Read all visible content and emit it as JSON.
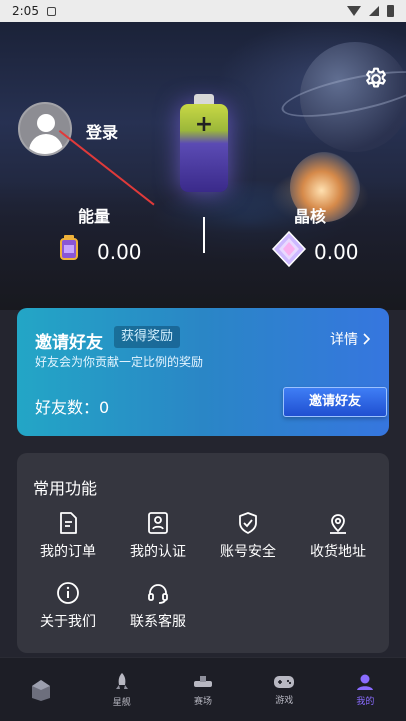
{
  "status_bar": {
    "time": "2:05"
  },
  "profile": {
    "login_label": "登录"
  },
  "stats": {
    "energy": {
      "label": "能量",
      "value": "0.00"
    },
    "crystal": {
      "label": "晶核",
      "value": "0.00"
    }
  },
  "invite": {
    "title": "邀请好友",
    "reward_tag": "获得奖励",
    "details_label": "详情",
    "subtitle": "好友会为你贡献一定比例的奖励",
    "friend_count_label": "好友数：0",
    "button_label": "邀请好友"
  },
  "functions": {
    "title": "常用功能",
    "items": [
      {
        "label": "我的订单",
        "icon": "order-icon"
      },
      {
        "label": "我的认证",
        "icon": "id-card-icon"
      },
      {
        "label": "账号安全",
        "icon": "shield-icon"
      },
      {
        "label": "收货地址",
        "icon": "location-icon"
      },
      {
        "label": "关于我们",
        "icon": "info-icon"
      },
      {
        "label": "联系客服",
        "icon": "headset-icon"
      }
    ]
  },
  "tabs": [
    {
      "label": "",
      "icon": "home-icon"
    },
    {
      "label": "星舰",
      "icon": "rocket-icon"
    },
    {
      "label": "赛场",
      "icon": "arena-icon"
    },
    {
      "label": "游戏",
      "icon": "gamepad-icon"
    },
    {
      "label": "我的",
      "icon": "user-icon",
      "active": true
    }
  ],
  "colors": {
    "accent": "#8a6cff",
    "invite_gradient_start": "#23a6c6",
    "invite_gradient_end": "#3676df",
    "panel_bg": "#35363f"
  }
}
